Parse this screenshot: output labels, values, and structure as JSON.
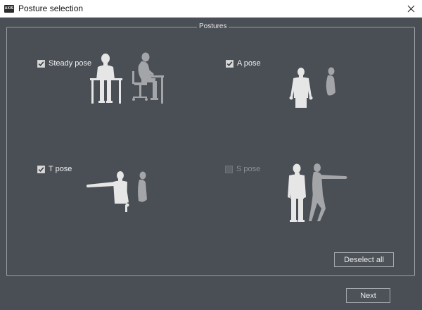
{
  "window": {
    "title": "Posture selection",
    "icon_text": "AXIS"
  },
  "group": {
    "title": "Postures"
  },
  "options": [
    {
      "label": "Steady pose",
      "checked": true,
      "enabled": true
    },
    {
      "label": "A pose",
      "checked": true,
      "enabled": true
    },
    {
      "label": "T pose",
      "checked": true,
      "enabled": true
    },
    {
      "label": "S pose",
      "checked": false,
      "enabled": false
    }
  ],
  "buttons": {
    "deselect_all": "Deselect all",
    "next": "Next"
  },
  "colors": {
    "background": "#4a4e55",
    "figure_front": "#e6e6e6",
    "figure_side": "#a3a5a8"
  }
}
